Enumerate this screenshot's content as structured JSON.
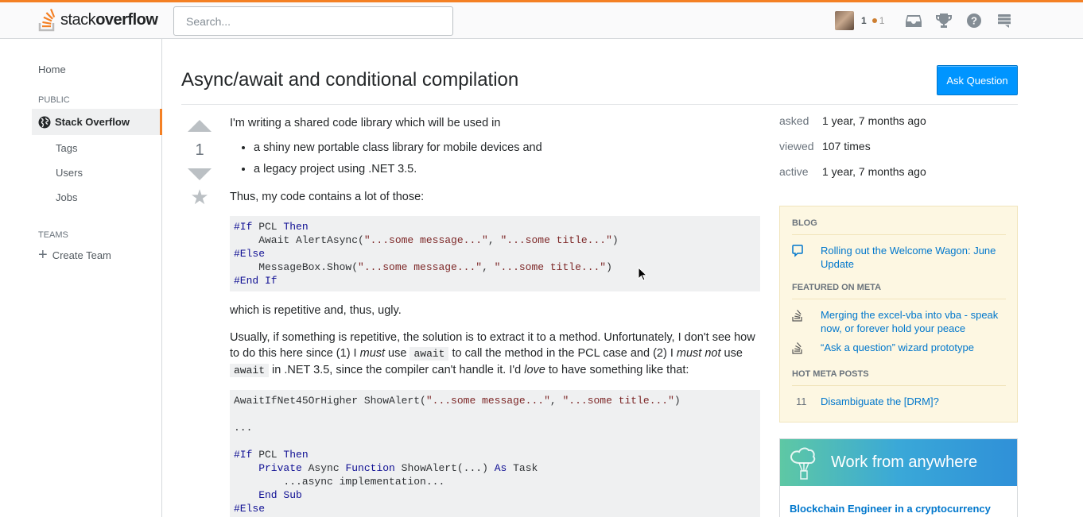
{
  "header": {
    "logo_text_light": "stack",
    "logo_text_bold": "overflow",
    "search_placeholder": "Search...",
    "reputation": "1",
    "bronze_badges": "1",
    "icons": [
      "inbox-icon",
      "achievements-icon",
      "help-icon",
      "site-switcher-icon"
    ]
  },
  "sidebar": {
    "home": "Home",
    "public_label": "PUBLIC",
    "active_site": "Stack Overflow",
    "items": [
      "Tags",
      "Users",
      "Jobs"
    ],
    "teams_label": "TEAMS",
    "create_team": "Create Team"
  },
  "question": {
    "title": "Async/await and conditional compilation",
    "ask_button": "Ask Question",
    "votes": "1",
    "intro": "I'm writing a shared code library which will be used in",
    "bullets": [
      "a shiny new portable class library for mobile devices and",
      "a legacy project using .NET 3.5."
    ],
    "thus": "Thus, my code contains a lot of those:",
    "code1": {
      "l1_kw": "#If",
      "l1_a": " PCL ",
      "l1_kw2": "Then",
      "l2_a": "    Await AlertAsync(",
      "l2_s1": "\"...some message...\"",
      "l2_b": ", ",
      "l2_s2": "\"...some title...\"",
      "l2_c": ")",
      "l3_kw": "#Else",
      "l4_a": "    MessageBox.Show(",
      "l4_s1": "\"...some message...\"",
      "l4_b": ", ",
      "l4_s2": "\"...some title...\"",
      "l4_c": ")",
      "l5_kw": "#End If"
    },
    "ugly": "which is repetitive and, thus, ugly.",
    "para": {
      "t1": "Usually, if something is repetitive, the solution is to extract it to a method. Unfortunately, I don't see how to do this here since (1) I ",
      "em1": "must",
      "t2": " use ",
      "code_await1": "await",
      "t3": " to call the method in the PCL case and (2) I ",
      "em2": "must not",
      "t4": " use ",
      "code_await2": "await",
      "t5": " in .NET 3.5, since the compiler can't handle it. I'd ",
      "em3": "love",
      "t6": " to have something like that:"
    },
    "code2": {
      "l1_a": "AwaitIfNet45OrHigher ShowAlert(",
      "l1_s1": "\"...some message...\"",
      "l1_b": ", ",
      "l1_s2": "\"...some title...\"",
      "l1_c": ")",
      "l2": "",
      "l3": "...",
      "l4": "",
      "l5_kw": "#If",
      "l5_a": " PCL ",
      "l5_kw2": "Then",
      "l6_kw": "    Private",
      "l6_a": " Async ",
      "l6_kw2": "Function",
      "l6_b": " ShowAlert(...) ",
      "l6_kw3": "As",
      "l6_c": " Task",
      "l7": "        ...async implementation...",
      "l8_kw": "    End Sub",
      "l9_kw": "#Else"
    }
  },
  "meta": [
    {
      "label": "asked",
      "value": "1 year, 7 months ago"
    },
    {
      "label": "viewed",
      "value": "107 times"
    },
    {
      "label": "active",
      "value": "1 year, 7 months ago"
    }
  ],
  "blog": {
    "blog_label": "BLOG",
    "blog_post": "Rolling out the Welcome Wagon: June Update",
    "featured_label": "FEATURED ON META",
    "featured": [
      "Merging the excel-vba into vba - speak now, or forever hold your peace",
      "“Ask a question” wizard prototype"
    ],
    "hot_label": "HOT META POSTS",
    "hot": [
      {
        "count": "11",
        "title": "Disambiguate the [DRM]?"
      }
    ]
  },
  "ad": {
    "banner": "Work from anywhere",
    "job_title": "Blockchain Engineer in a cryptocurrency"
  },
  "colors": {
    "accent": "#f48024",
    "primary": "#0095ff",
    "link": "#0077cc"
  }
}
